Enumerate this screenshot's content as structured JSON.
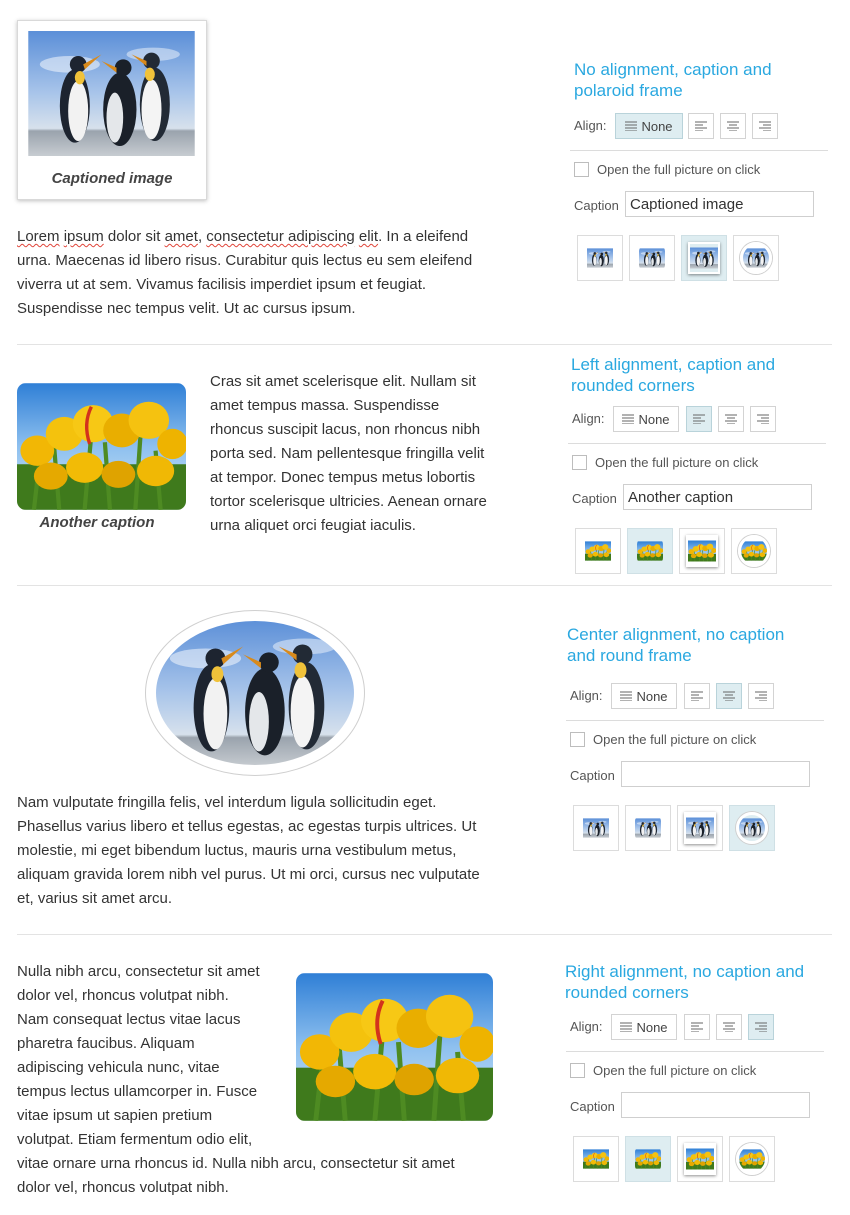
{
  "sections": [
    {
      "title": "No alignment, caption and polaroid frame",
      "caption_display": "Captioned image",
      "caption_value": "Captioned image",
      "image": "penguins",
      "frame": "polaroid",
      "alignment": "none",
      "open_full_picture": false,
      "paragraph": {
        "lead_words": [
          "Lorem",
          " ",
          "ipsum",
          " dolor sit ",
          "amet",
          ", ",
          "consectetur adipiscing",
          " ",
          "elit",
          "."
        ],
        "rest": " In a eleifend urna. Maecenas id libero risus. Curabitur quis lectus eu sem eleifend viverra ut at sem. Vivamus facilisis imperdiet ipsum et feugiat. Suspendisse nec tempus velit. Ut ac cursus ipsum."
      }
    },
    {
      "title": "Left alignment, caption and rounded corners",
      "caption_display": "Another caption",
      "caption_value": "Another caption",
      "image": "tulips",
      "frame": "rounded",
      "alignment": "left",
      "open_full_picture": false,
      "paragraph": "Cras sit amet scelerisque elit. Nullam sit amet tempus massa. Suspendisse rhoncus suscipit lacus, non rhoncus nibh porta sed. Nam pellentesque fringilla velit at tempor. Donec tempus metus lobortis tortor scelerisque ultricies. Aenean ornare urna aliquet orci feugiat iaculis."
    },
    {
      "title": "Center alignment, no caption and round frame",
      "caption_value": "",
      "image": "penguins",
      "frame": "round",
      "alignment": "center",
      "open_full_picture": false,
      "paragraph": "Nam vulputate fringilla felis, vel interdum ligula sollicitudin eget. Phasellus varius libero et tellus egestas, ac egestas turpis ultrices. Ut molestie, mi eget bibendum luctus, mauris urna vestibulum metus, aliquam gravida lorem nibh vel purus. Ut mi orci, cursus nec vulputate et, varius sit amet arcu."
    },
    {
      "title": "Right alignment, no caption and rounded corners",
      "caption_value": "",
      "image": "tulips",
      "frame": "rounded",
      "alignment": "right",
      "open_full_picture": false,
      "paragraph_lines": [
        "Nulla nibh arcu, consectetur sit amet",
        "dolor vel, rhoncus volutpat nibh.",
        "Nam consequat lectus vitae lacus",
        "pharetra faucibus. Aliquam",
        "adipiscing vehicula nunc, vitae",
        "tempus lectus ullamcorper in. Fusce",
        "vitae ipsum ut sapien pretium",
        "volutpat. Etiam fermentum odio elit,",
        "vitae ornare urna rhoncus id.  Nulla nibh arcu, consectetur sit amet",
        "dolor vel, rhoncus volutpat nibh."
      ]
    }
  ],
  "labels": {
    "align": "Align:",
    "none": "None",
    "open_full": "Open the full picture on click",
    "caption": "Caption"
  },
  "align_options": [
    "none",
    "left",
    "center",
    "right"
  ],
  "frame_options": [
    "none",
    "rounded",
    "polaroid",
    "round"
  ],
  "colors": {
    "accent": "#2aa8e0",
    "active_bg": "#deedf1",
    "divider": "#e3e3e3",
    "spell_underline": "#e0453a"
  },
  "icons": [
    "align-none-icon",
    "align-left-icon",
    "align-center-icon",
    "align-right-icon",
    "checkbox-icon"
  ]
}
